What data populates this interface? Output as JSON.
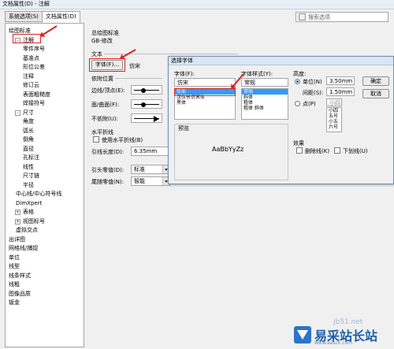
{
  "window": {
    "title": "文档属性(D) - 注解"
  },
  "tabs": [
    {
      "label": "系统选项(S)"
    },
    {
      "label": "文档属性(D)"
    }
  ],
  "search": {
    "placeholder": "搜索选项"
  },
  "tree": [
    {
      "label": "绘图标准",
      "indent": 0,
      "toggle": ""
    },
    {
      "label": "注解",
      "indent": 1,
      "toggle": "-"
    },
    {
      "label": "零件序号",
      "indent": 2,
      "toggle": ""
    },
    {
      "label": "基准点",
      "indent": 2,
      "toggle": ""
    },
    {
      "label": "形位公差",
      "indent": 2,
      "toggle": ""
    },
    {
      "label": "注释",
      "indent": 2,
      "toggle": ""
    },
    {
      "label": "修订云",
      "indent": 2,
      "toggle": ""
    },
    {
      "label": "表面粗糙度",
      "indent": 2,
      "toggle": ""
    },
    {
      "label": "焊接符号",
      "indent": 2,
      "toggle": ""
    },
    {
      "label": "尺寸",
      "indent": 1,
      "toggle": "-"
    },
    {
      "label": "角度",
      "indent": 2,
      "toggle": ""
    },
    {
      "label": "弧长",
      "indent": 2,
      "toggle": ""
    },
    {
      "label": "倒角",
      "indent": 2,
      "toggle": ""
    },
    {
      "label": "直径",
      "indent": 2,
      "toggle": ""
    },
    {
      "label": "孔标注",
      "indent": 2,
      "toggle": ""
    },
    {
      "label": "线性",
      "indent": 2,
      "toggle": ""
    },
    {
      "label": "尺寸链",
      "indent": 2,
      "toggle": ""
    },
    {
      "label": "半径",
      "indent": 2,
      "toggle": ""
    },
    {
      "label": "中心线/中心符号线",
      "indent": 1,
      "toggle": ""
    },
    {
      "label": "DimXpert",
      "indent": 1,
      "toggle": ""
    },
    {
      "label": "表格",
      "indent": 1,
      "toggle": "+"
    },
    {
      "label": "视图标号",
      "indent": 1,
      "toggle": "+"
    },
    {
      "label": "虚拟交点",
      "indent": 1,
      "toggle": ""
    },
    {
      "label": "出详图",
      "indent": 0,
      "toggle": ""
    },
    {
      "label": "网格线/捕捉",
      "indent": 0,
      "toggle": ""
    },
    {
      "label": "单位",
      "indent": 0,
      "toggle": ""
    },
    {
      "label": "线型",
      "indent": 0,
      "toggle": ""
    },
    {
      "label": "线条样式",
      "indent": 0,
      "toggle": ""
    },
    {
      "label": "线粗",
      "indent": 0,
      "toggle": ""
    },
    {
      "label": "图像品质",
      "indent": 0,
      "toggle": ""
    },
    {
      "label": "钣金",
      "indent": 0,
      "toggle": ""
    }
  ],
  "panel": {
    "standard_label": "总绘图标准",
    "standard_value": "GB-修改",
    "text_section": "文本",
    "font_button": "字体(F)...",
    "font_value": "仿宋",
    "attach_section": "依附位置",
    "edge_label": "边线/顶点(E):",
    "face_label": "面/曲面(F):",
    "unattached_label": "不依附(U):",
    "leader_section": "水平折线",
    "use_horizontal": "使用水平折线(B)",
    "leader_length_label": "引线长度(D):",
    "leader_length_value": "6.35mm",
    "leader_zero_label": "引头零值(D):",
    "leader_zero_value": "标准",
    "trailing_zero_label": "尾随零值(N):",
    "trailing_zero_value": "智能"
  },
  "font_dialog": {
    "title": "选择字体",
    "font_label": "字体(F):",
    "font_value": "仿宋",
    "font_list": [
      "仿宋",
      "汉仪长仿宋体",
      "黑体"
    ],
    "style_label": "字体样式(Y):",
    "style_value": "常规",
    "style_list": [
      "常规",
      "斜体",
      "粗体",
      "粗体 斜体"
    ],
    "height_label": "高度:",
    "unit_label": "单位(N)",
    "unit_value": "3.50mm",
    "spacing_label": "间距(S):",
    "spacing_value": "1.50mm",
    "point_label": "点(P)",
    "point_list": [
      "小四",
      "五号",
      "小五",
      "六号"
    ],
    "ok_button": "确定",
    "cancel_button": "取消",
    "preview_label": "预览",
    "preview_text": "AaBbYyZz",
    "effects_label": "效果",
    "strike_label": "删除线(K)",
    "underline_label": "下划线(U)"
  },
  "watermark": {
    "text": "易采站长站",
    "url": "www.easck.com",
    "small": "jb51.net"
  },
  "colors": {
    "highlight": "#e02020",
    "selection": "#3399ff",
    "watermark": "#1f5fa8"
  }
}
